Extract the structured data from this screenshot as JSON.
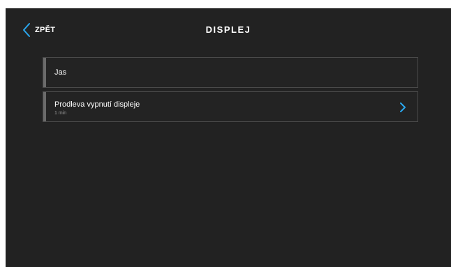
{
  "header": {
    "back_label": "ZPĚT",
    "title": "DISPLEJ"
  },
  "settings": [
    {
      "label": "Jas"
    },
    {
      "label": "Prodleva vypnutí displeje",
      "value": "1 min"
    }
  ],
  "colors": {
    "accent": "#2aa8f0",
    "background": "#222222",
    "row_border": "#4a4a4a",
    "text": "#ffffff"
  },
  "icons": {
    "back": "chevron-left-icon",
    "row_nav": "chevron-right-icon"
  }
}
